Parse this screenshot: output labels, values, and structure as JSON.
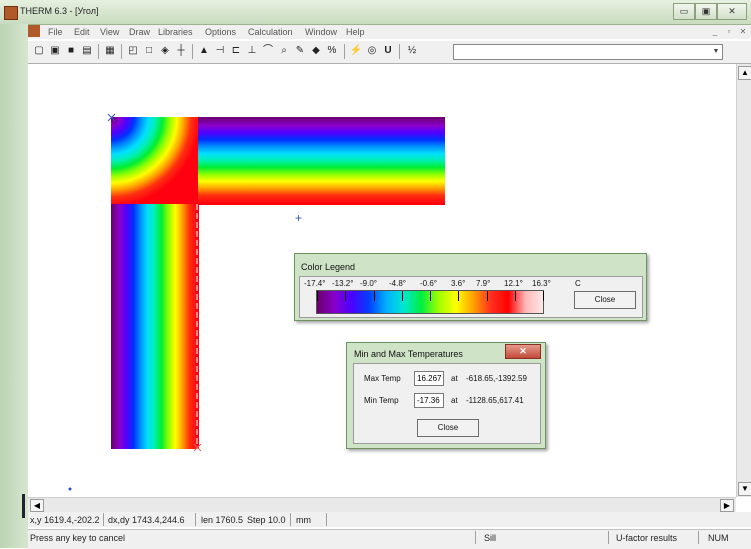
{
  "window": {
    "title": "THERM 6.3 - [Угол]",
    "min_glyph": "▭",
    "max_glyph": "▣",
    "close_glyph": "✕"
  },
  "menu": {
    "items": [
      "File",
      "Edit",
      "View",
      "Draw",
      "Libraries",
      "Options",
      "Calculation",
      "Window",
      "Help"
    ],
    "mdi_buttons": [
      "_",
      "▫",
      "✕"
    ]
  },
  "toolbar": {
    "icons": [
      "new-icon",
      "open-icon",
      "save-icon",
      "print-icon",
      "grid-icon",
      "polygon-icon",
      "rectangle-icon",
      "fill-icon",
      "locator-icon",
      "cursor-icon",
      "insert-point-icon",
      "insert-icon",
      "snap-icon",
      "zoom-icon",
      "pencil-icon",
      "rotate-icon",
      "material-icon",
      "boundary-icon",
      "calculate-icon",
      "display-icon",
      "u-factor-icon",
      "mesh-icon"
    ],
    "glyphs": [
      "▢",
      "▣",
      "■",
      "▤",
      "▦",
      "◰",
      "□",
      "◈",
      "┼",
      "▲",
      "⊣",
      "⊏",
      "⊥",
      "⌒",
      "⌕",
      "✎",
      "◆",
      "%",
      "⚡",
      "◎",
      "U",
      "½"
    ],
    "combo_value": ""
  },
  "legend": {
    "title": "Color Legend",
    "ticks": [
      "-17.4°",
      "-13.2°",
      "-9.0°",
      "-4.8°",
      "-0.6°",
      "3.6°",
      "7.9°",
      "12.1°",
      "16.3°"
    ],
    "unit": "C",
    "close_label": "Close",
    "stops": [
      "#6a006a",
      "#8800cc",
      "#4b00ff",
      "#0040ff",
      "#00b0ff",
      "#00e8d0",
      "#00ee40",
      "#a0ff00",
      "#ffff00",
      "#ffa000",
      "#ff3020",
      "#ff0000",
      "#ffb8b8",
      "#ffe8e8"
    ]
  },
  "minmax": {
    "title": "Min and Max Temperatures",
    "max_label": "Max Temp",
    "max_value": "16.267",
    "max_at": "at",
    "max_coords": "-618.65,-1392.59",
    "min_label": "Min Temp",
    "min_value": "-17.36",
    "min_at": "at",
    "min_coords": "-1128.65,617.41",
    "close_label": "Close",
    "x_glyph": "✕"
  },
  "canvas": {
    "marker_plus": "+"
  },
  "status": {
    "coords": "x,y 1619.4,-202.2",
    "delta": "dx,dy 1743.4,244.6",
    "len": "len 1760.5",
    "step": "Step 10.0",
    "unit": "mm",
    "hint": "Press any key to cancel",
    "boundary": "Sill",
    "results": "U-factor results",
    "num": "NUM"
  },
  "scroll": {
    "up": "▲",
    "down": "▼",
    "left": "◀",
    "right": "▶"
  }
}
